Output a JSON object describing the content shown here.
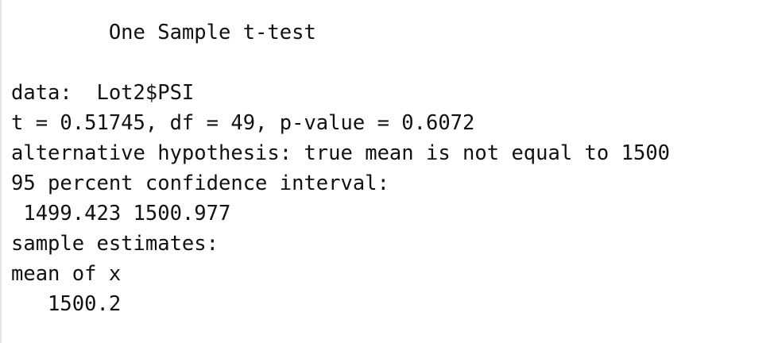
{
  "output": {
    "title": "        One Sample t-test",
    "blank": "",
    "data_line": "data:  Lot2$PSI",
    "stats_line": "t = 0.51745, df = 49, p-value = 0.6072",
    "alt_line": "alternative hypothesis: true mean is not equal to 1500",
    "ci_header": "95 percent confidence interval:",
    "ci_values": " 1499.423 1500.977",
    "estimates_header": "sample estimates:",
    "estimate_label": "mean of x",
    "estimate_value": "   1500.2"
  }
}
